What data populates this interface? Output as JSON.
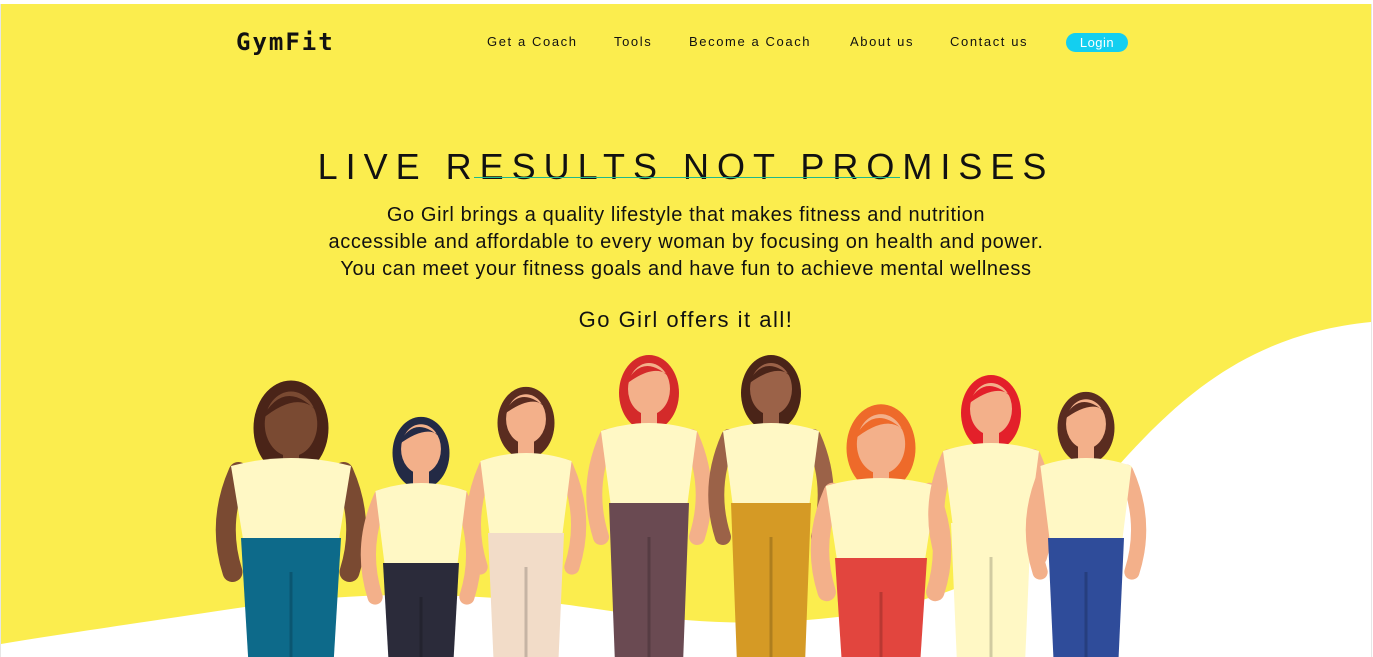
{
  "brand": {
    "logo": "GymFit"
  },
  "nav": {
    "items": [
      "Get a Coach",
      "Tools",
      "Become a Coach",
      "About us",
      "Contact us"
    ],
    "login_label": "Login"
  },
  "hero": {
    "headline": "LIVE RESULTS NOT PROMISES",
    "description_lines": [
      "Go Girl brings a quality lifestyle that makes fitness and nutrition",
      "accessible and affordable to every woman by focusing on health and power.",
      "You can meet your fitness goals and have fun to achieve mental wellness"
    ],
    "tagline": "Go Girl offers it all!"
  },
  "colors": {
    "background": "#fbed4e",
    "accent": "#13cff0",
    "divider": "#1fb78b",
    "wave": "#ffffff"
  },
  "illustration": {
    "subject": "group-of-diverse-women-illustration",
    "figures": [
      {
        "name": "woman-teal-pants",
        "skin": "#7a4a32",
        "hair": "#4a2418",
        "top": "#fff8c5",
        "bottom": "#0d6a8a"
      },
      {
        "name": "woman-laptop-skirt",
        "skin": "#f3b08a",
        "hair": "#232a45",
        "top": "#fff8c5",
        "bottom": "#2b2b3a"
      },
      {
        "name": "woman-raised-fist-prosthetic",
        "skin": "#f3b08a",
        "hair": "#5a2c20",
        "top": "#fff8c5",
        "bottom": "#f2dcc8"
      },
      {
        "name": "woman-red-hijab",
        "skin": "#f3b08a",
        "hair": "#d42a2a",
        "top": "#fff8c5",
        "bottom": "#6a4a52"
      },
      {
        "name": "woman-mustard-pants",
        "skin": "#9b6248",
        "hair": "#4a2418",
        "top": "#fff8c5",
        "bottom": "#d59a25"
      },
      {
        "name": "woman-curly-red-hair",
        "skin": "#f3b08a",
        "hair": "#ee6a2a",
        "top": "#fff8c5",
        "bottom": "#e2453e"
      },
      {
        "name": "woman-pregnant-dress",
        "skin": "#f3b08a",
        "hair": "#e3202a",
        "top": "#fff8c5",
        "bottom": "#fff8c5"
      },
      {
        "name": "woman-blue-jeans",
        "skin": "#f3b08a",
        "hair": "#5a2c20",
        "top": "#fff8c5",
        "bottom": "#2f4c9a"
      }
    ]
  }
}
